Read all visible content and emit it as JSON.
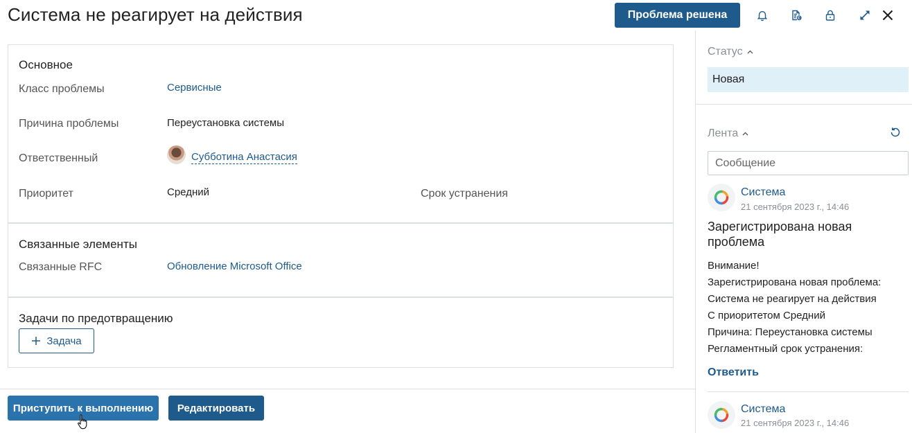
{
  "header": {
    "title": "Система не реагирует на действия",
    "resolve_button": "Проблема решена",
    "icons": [
      "bell-icon",
      "document-export-icon",
      "lock-icon",
      "expand-icon",
      "close-icon"
    ]
  },
  "main": {
    "basic": {
      "title": "Основное",
      "problem_class_label": "Класс проблемы",
      "problem_class_value": "Сервисные",
      "cause_label": "Причина проблемы",
      "cause_value": "Переустановка системы",
      "responsible_label": "Ответственный",
      "responsible_value": "Субботина Анастасия",
      "priority_label": "Приоритет",
      "priority_value": "Средний",
      "deadline_label": "Срок устранения"
    },
    "related": {
      "title": "Связанные элементы",
      "rfc_label": "Связанные RFC",
      "rfc_value": "Обновление Microsoft Office"
    },
    "prevention": {
      "title": "Задачи по предотвращению",
      "add_task_label": "Задача"
    }
  },
  "footer": {
    "start_button": "Приступить к выполнению",
    "edit_button": "Редактировать"
  },
  "sidebar": {
    "status_label": "Статус",
    "status_value": "Новая",
    "feed_label": "Лента",
    "message_placeholder": "Сообщение",
    "feed": [
      {
        "author": "Система",
        "time": "21 сентября 2023 г., 14:46",
        "title": "Зарегистрирована новая проблема",
        "body": [
          "Внимание!",
          "Зарегистрирована новая проблема:",
          "Система не реагирует на действия",
          "С приоритетом Средний",
          "Причина: Переустановка системы",
          "Регламентный срок устранения:"
        ],
        "reply": "Ответить"
      },
      {
        "author": "Система",
        "time": "21 сентября 2023 г., 14:46"
      }
    ]
  },
  "colors": {
    "brand": "#1f5a8c",
    "status_bg": "#dff0f8",
    "border": "#dcdfe3"
  }
}
